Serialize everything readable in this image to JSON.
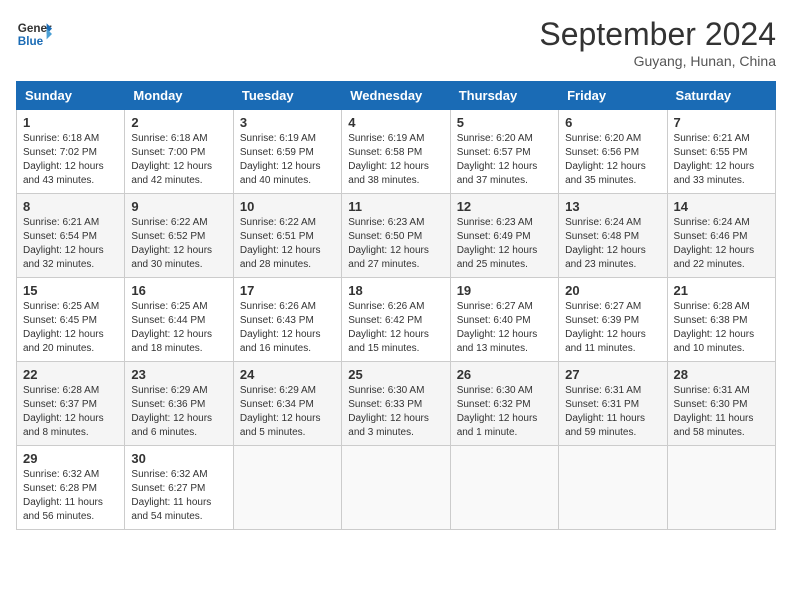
{
  "header": {
    "logo_line1": "General",
    "logo_line2": "Blue",
    "month": "September 2024",
    "location": "Guyang, Hunan, China"
  },
  "weekdays": [
    "Sunday",
    "Monday",
    "Tuesday",
    "Wednesday",
    "Thursday",
    "Friday",
    "Saturday"
  ],
  "weeks": [
    [
      {
        "day": "1",
        "sunrise": "6:18 AM",
        "sunset": "7:02 PM",
        "daylight": "12 hours and 43 minutes."
      },
      {
        "day": "2",
        "sunrise": "6:18 AM",
        "sunset": "7:00 PM",
        "daylight": "12 hours and 42 minutes."
      },
      {
        "day": "3",
        "sunrise": "6:19 AM",
        "sunset": "6:59 PM",
        "daylight": "12 hours and 40 minutes."
      },
      {
        "day": "4",
        "sunrise": "6:19 AM",
        "sunset": "6:58 PM",
        "daylight": "12 hours and 38 minutes."
      },
      {
        "day": "5",
        "sunrise": "6:20 AM",
        "sunset": "6:57 PM",
        "daylight": "12 hours and 37 minutes."
      },
      {
        "day": "6",
        "sunrise": "6:20 AM",
        "sunset": "6:56 PM",
        "daylight": "12 hours and 35 minutes."
      },
      {
        "day": "7",
        "sunrise": "6:21 AM",
        "sunset": "6:55 PM",
        "daylight": "12 hours and 33 minutes."
      }
    ],
    [
      {
        "day": "8",
        "sunrise": "6:21 AM",
        "sunset": "6:54 PM",
        "daylight": "12 hours and 32 minutes."
      },
      {
        "day": "9",
        "sunrise": "6:22 AM",
        "sunset": "6:52 PM",
        "daylight": "12 hours and 30 minutes."
      },
      {
        "day": "10",
        "sunrise": "6:22 AM",
        "sunset": "6:51 PM",
        "daylight": "12 hours and 28 minutes."
      },
      {
        "day": "11",
        "sunrise": "6:23 AM",
        "sunset": "6:50 PM",
        "daylight": "12 hours and 27 minutes."
      },
      {
        "day": "12",
        "sunrise": "6:23 AM",
        "sunset": "6:49 PM",
        "daylight": "12 hours and 25 minutes."
      },
      {
        "day": "13",
        "sunrise": "6:24 AM",
        "sunset": "6:48 PM",
        "daylight": "12 hours and 23 minutes."
      },
      {
        "day": "14",
        "sunrise": "6:24 AM",
        "sunset": "6:46 PM",
        "daylight": "12 hours and 22 minutes."
      }
    ],
    [
      {
        "day": "15",
        "sunrise": "6:25 AM",
        "sunset": "6:45 PM",
        "daylight": "12 hours and 20 minutes."
      },
      {
        "day": "16",
        "sunrise": "6:25 AM",
        "sunset": "6:44 PM",
        "daylight": "12 hours and 18 minutes."
      },
      {
        "day": "17",
        "sunrise": "6:26 AM",
        "sunset": "6:43 PM",
        "daylight": "12 hours and 16 minutes."
      },
      {
        "day": "18",
        "sunrise": "6:26 AM",
        "sunset": "6:42 PM",
        "daylight": "12 hours and 15 minutes."
      },
      {
        "day": "19",
        "sunrise": "6:27 AM",
        "sunset": "6:40 PM",
        "daylight": "12 hours and 13 minutes."
      },
      {
        "day": "20",
        "sunrise": "6:27 AM",
        "sunset": "6:39 PM",
        "daylight": "12 hours and 11 minutes."
      },
      {
        "day": "21",
        "sunrise": "6:28 AM",
        "sunset": "6:38 PM",
        "daylight": "12 hours and 10 minutes."
      }
    ],
    [
      {
        "day": "22",
        "sunrise": "6:28 AM",
        "sunset": "6:37 PM",
        "daylight": "12 hours and 8 minutes."
      },
      {
        "day": "23",
        "sunrise": "6:29 AM",
        "sunset": "6:36 PM",
        "daylight": "12 hours and 6 minutes."
      },
      {
        "day": "24",
        "sunrise": "6:29 AM",
        "sunset": "6:34 PM",
        "daylight": "12 hours and 5 minutes."
      },
      {
        "day": "25",
        "sunrise": "6:30 AM",
        "sunset": "6:33 PM",
        "daylight": "12 hours and 3 minutes."
      },
      {
        "day": "26",
        "sunrise": "6:30 AM",
        "sunset": "6:32 PM",
        "daylight": "12 hours and 1 minute."
      },
      {
        "day": "27",
        "sunrise": "6:31 AM",
        "sunset": "6:31 PM",
        "daylight": "11 hours and 59 minutes."
      },
      {
        "day": "28",
        "sunrise": "6:31 AM",
        "sunset": "6:30 PM",
        "daylight": "11 hours and 58 minutes."
      }
    ],
    [
      {
        "day": "29",
        "sunrise": "6:32 AM",
        "sunset": "6:28 PM",
        "daylight": "11 hours and 56 minutes."
      },
      {
        "day": "30",
        "sunrise": "6:32 AM",
        "sunset": "6:27 PM",
        "daylight": "11 hours and 54 minutes."
      },
      null,
      null,
      null,
      null,
      null
    ]
  ]
}
